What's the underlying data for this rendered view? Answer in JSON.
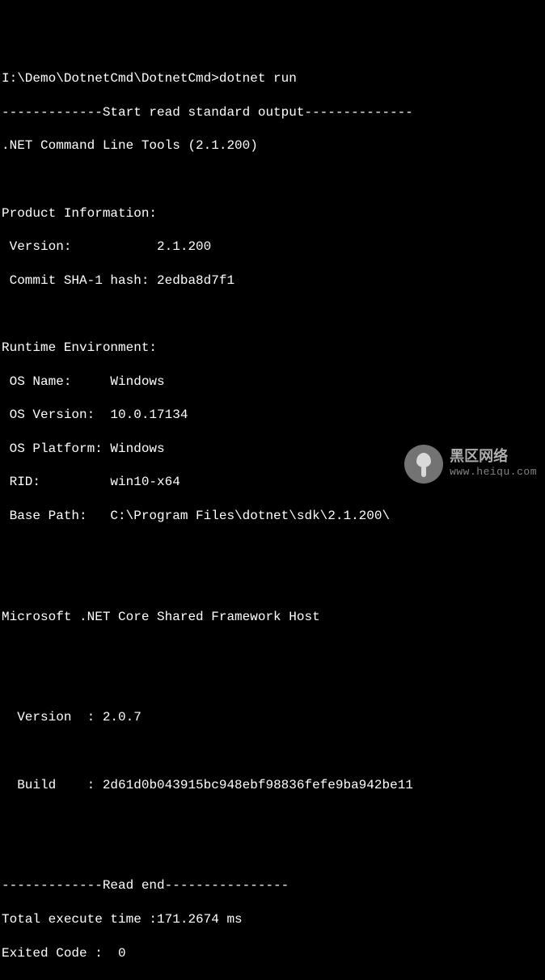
{
  "prompt": {
    "path": "I:\\Demo\\DotnetCmd\\DotnetCmd>",
    "command": "dotnet run"
  },
  "divider_start": "-------------Start read standard output--------------",
  "header_line": ".NET Command Line Tools (2.1.200)",
  "product_info": {
    "title": "Product Information:",
    "version_label": " Version:           ",
    "version_value": "2.1.200",
    "commit_label": " Commit SHA-1 hash: ",
    "commit_value": "2edba8d7f1"
  },
  "runtime_env": {
    "title": "Runtime Environment:",
    "os_name_label": " OS Name:     ",
    "os_name_value": "Windows",
    "os_version_label": " OS Version:  ",
    "os_version_value": "10.0.17134",
    "os_platform_label": " OS Platform: ",
    "os_platform_value": "Windows",
    "rid_label": " RID:         ",
    "rid_value": "win10-x64",
    "base_path_label": " Base Path:   ",
    "base_path_value": "C:\\Program Files\\dotnet\\sdk\\2.1.200\\"
  },
  "framework_host": {
    "title": "Microsoft .NET Core Shared Framework Host",
    "version_label": "  Version  : ",
    "version_value": "2.0.7",
    "build_label": "  Build    : ",
    "build_value": "2d61d0b043915bc948ebf98836fefe9ba942be11"
  },
  "divider_end": "-------------Read end----------------",
  "footer": {
    "time_label": "Total execute time :",
    "time_value": "171.2674 ms",
    "exit_label": "Exited Code :  ",
    "exit_value": "0"
  },
  "watermark": {
    "cn": "黑区网络",
    "url": "www.heiqu.com"
  }
}
